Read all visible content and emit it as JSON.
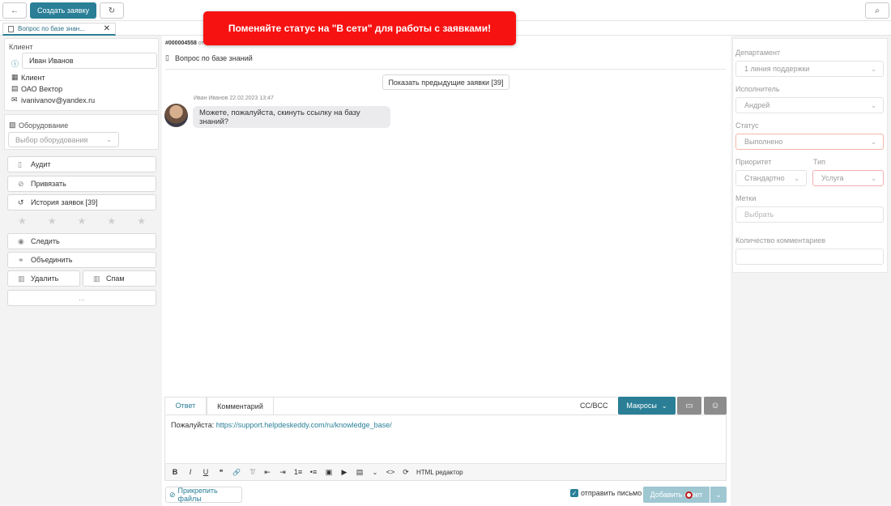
{
  "topbar": {
    "back_icon": "←",
    "create_label": "Создать заявку",
    "refresh_icon": "↻",
    "search_icon": "⌕"
  },
  "tab": {
    "title": "Вопрос по базе знан...",
    "close": "✕"
  },
  "banner": {
    "text": "Поменяйте статус на \"В сети\" для работы с заявками!"
  },
  "client": {
    "heading": "Клиент",
    "name": "Иван Иванов",
    "type": "Клиент",
    "company": "ОАО Вектор",
    "email": "ivanivanov@yandex.ru"
  },
  "equipment": {
    "heading": "Оборудование",
    "placeholder": "Выбор оборудования"
  },
  "actions": {
    "audit": "Аудит",
    "link": "Привязать",
    "history": "История заявок [39]",
    "follow": "Следить",
    "merge": "Объединить",
    "delete": "Удалить",
    "spam": "Спам",
    "more": "..."
  },
  "rating": {
    "stars": [
      "★",
      "★",
      "★",
      "★",
      "★"
    ]
  },
  "ticket": {
    "id": "#000004558",
    "id_suffix": "от",
    "subject": "Вопрос по базе знаний",
    "show_prev": "Показать предыдущие заявки [39]"
  },
  "message": {
    "meta": "Иван Иванов 22.02.2023 13:47",
    "text": "Можете, пожалуйста, скинуть ссылку на базу знаний?"
  },
  "composer": {
    "tab_reply": "Ответ",
    "tab_comment": "Комментарий",
    "cc_bcc": "CC/BCC",
    "macros": "Макросы",
    "body_prefix": "Пожалуйста: ",
    "body_link": "https://support.helpdeskeddy.com/ru/knowledge_base/",
    "html_editor": "HTML редактор",
    "attach": "Прикрепить файлы",
    "send_mail": "отправить письмо",
    "add_reply": "Добавить ответ"
  },
  "toolbar": {
    "bold": "B",
    "italic": "I",
    "underline": "U",
    "quote": "❝",
    "link": "🔗",
    "clear": "T̸",
    "outdent": "⇤",
    "indent": "⇥",
    "ol": "1≡",
    "ul": "•≡",
    "image": "▣",
    "video": "▶",
    "template": "▤",
    "code": "<>"
  },
  "sidebar": {
    "department_label": "Департамент",
    "department_value": "1 линия поддержки",
    "assignee_label": "Исполнитель",
    "assignee_value": "Андрей",
    "status_label": "Статус",
    "status_value": "Выполнено",
    "priority_label": "Приоритет",
    "priority_value": "Стандартно",
    "type_label": "Тип",
    "type_value": "Услуга",
    "tags_label": "Метки",
    "tags_placeholder": "Выбрать",
    "comments_label": "Количество комментариев"
  },
  "colors": {
    "accent": "#2a7f97",
    "banner": "#f71212",
    "status_border": "#f2b8a8",
    "type_border": "#f2b0b0"
  }
}
